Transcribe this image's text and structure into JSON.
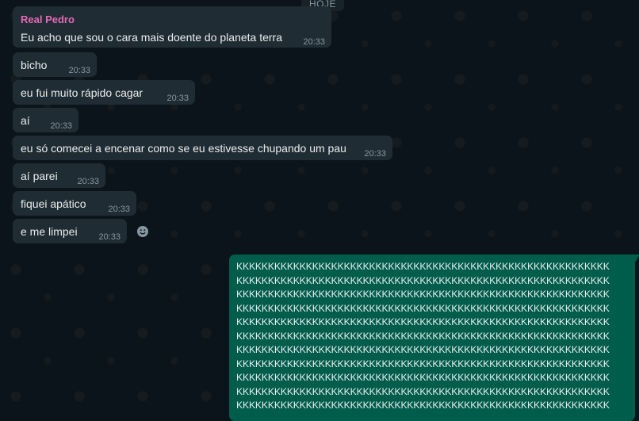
{
  "date_chip": "HOJE",
  "sender": "Real Pedro",
  "messages": [
    {
      "text": "Eu acho que sou o cara mais doente do planeta terra",
      "time": "20:33"
    },
    {
      "text": "bicho",
      "time": "20:33"
    },
    {
      "text": "eu fui muito rápido cagar",
      "time": "20:33"
    },
    {
      "text": "aí",
      "time": "20:33"
    },
    {
      "text": "eu só comecei a encenar como se eu estivesse chupando um pau",
      "time": "20:33"
    },
    {
      "text": "aí parei",
      "time": "20:33"
    },
    {
      "text": "fiquei apático",
      "time": "20:33"
    },
    {
      "text": "e me limpei",
      "time": "20:33"
    }
  ],
  "outgoing": {
    "lines": [
      "KKKKKKKKKKKKKKKKKKKKKKKKKKKKKKKKKKKKKKKKKKKKKKKKKKKKKKKKKKK",
      "KKKKKKKKKKKKKKKKKKKKKKKKKKKKKKKKKKKKKKKKKKKKKKKKKKKKKKKKKKK",
      "KKKKKKKKKKKKKKKKKKKKKKKKKKKKKKKKKKKKKKKKKKKKKKKKKKKKKKKKKKK",
      "KKKKKKKKKKKKKKKKKKKKKKKKKKKKKKKKKKKKKKKKKKKKKKKKKKKKKKKKKKK",
      "KKKKKKKKKKKKKKKKKKKKKKKKKKKKKKKKKKKKKKKKKKKKKKKKKKKKKKKKKKK",
      "KKKKKKKKKKKKKKKKKKKKKKKKKKKKKKKKKKKKKKKKKKKKKKKKKKKKKKKKKKK",
      "KKKKKKKKKKKKKKKKKKKKKKKKKKKKKKKKKKKKKKKKKKKKKKKKKKKKKKKKKKK",
      "KKKKKKKKKKKKKKKKKKKKKKKKKKKKKKKKKKKKKKKKKKKKKKKKKKKKKKKKKKK",
      "KKKKKKKKKKKKKKKKKKKKKKKKKKKKKKKKKKKKKKKKKKKKKKKKKKKKKKKKKKK",
      "KKKKKKKKKKKKKKKKKKKKKKKKKKKKKKKKKKKKKKKKKKKKKKKKKKKKKKKKKKK",
      "KKKKKKKKKKKKKKKKKKKKKKKKKKKKKKKKKKKKKKKKKKKKKKKKKKKKKKKKKKK"
    ]
  },
  "colors": {
    "background": "#0b141a",
    "incoming_bubble": "#202c33",
    "outgoing_bubble": "#005c4b",
    "sender_name": "#e26ab6",
    "timestamp": "#8696a0"
  },
  "icons": {
    "reaction": "emoji-react-icon"
  }
}
